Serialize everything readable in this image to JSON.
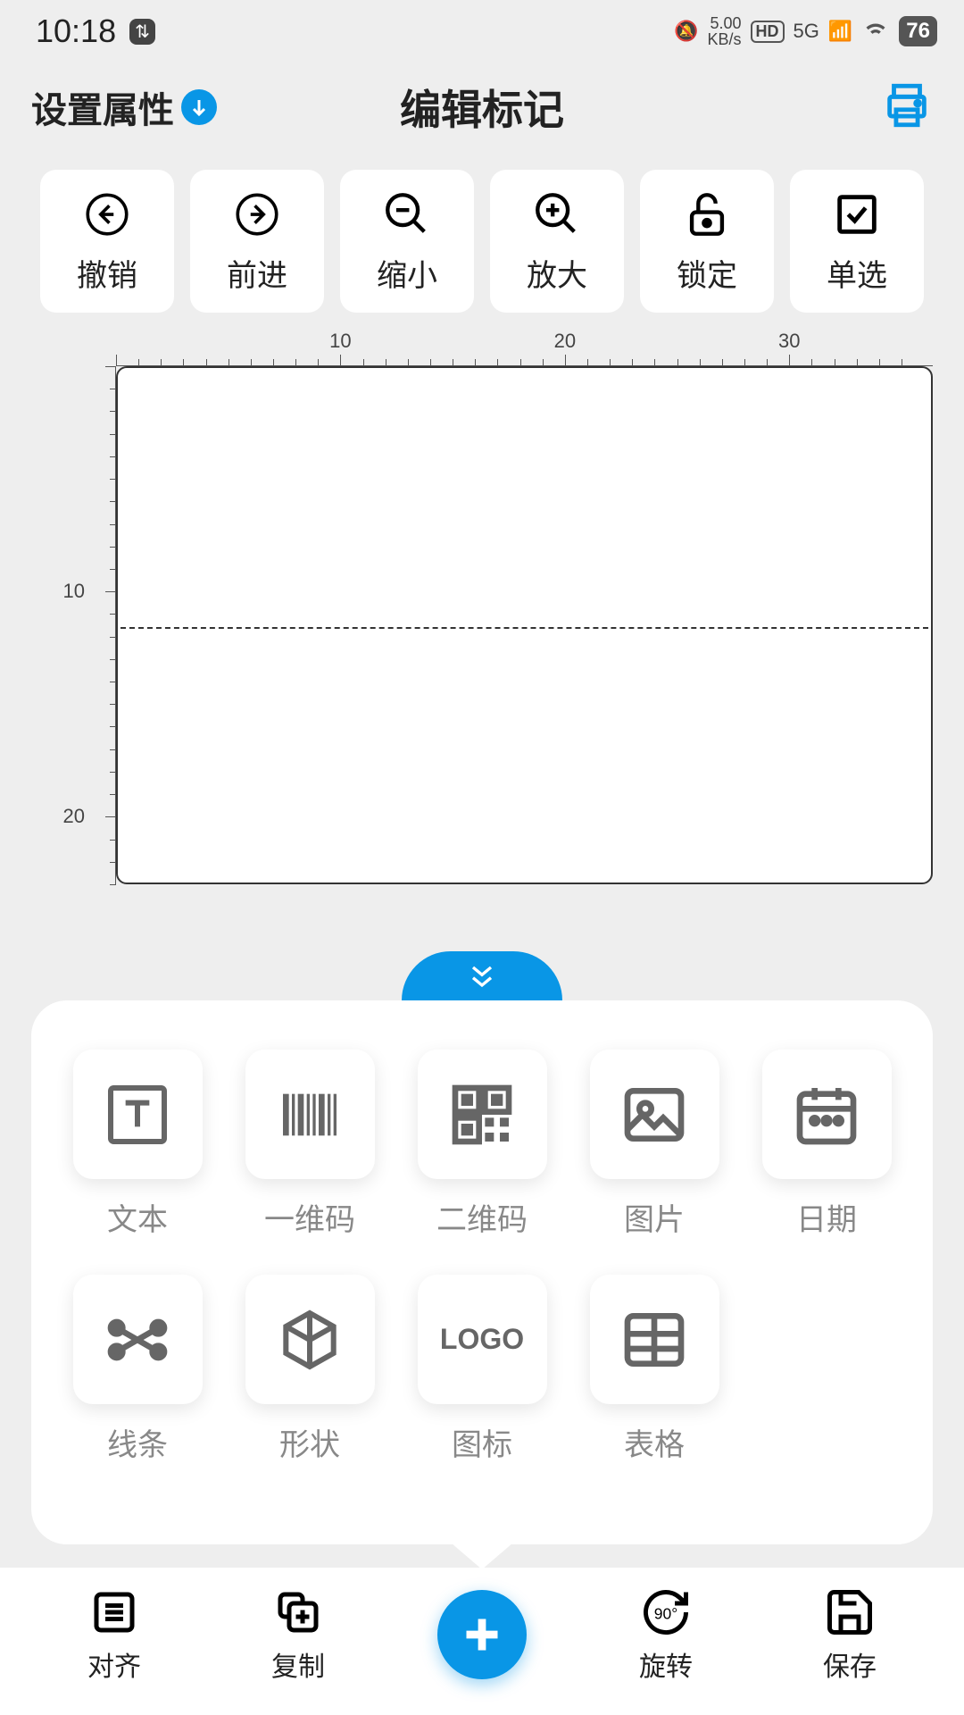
{
  "status": {
    "time": "10:18",
    "speed_val": "5.00",
    "speed_unit": "KB/s",
    "hd": "HD",
    "network": "5G",
    "battery": "76"
  },
  "header": {
    "settings": "设置属性",
    "title": "编辑标记"
  },
  "toolbar": {
    "undo": "撤销",
    "redo": "前进",
    "zoom_out": "缩小",
    "zoom_in": "放大",
    "lock": "锁定",
    "select": "单选"
  },
  "ruler": {
    "h": [
      "10",
      "20",
      "30"
    ],
    "v": [
      "10",
      "20"
    ]
  },
  "panel": {
    "text": "文本",
    "barcode": "一维码",
    "qrcode": "二维码",
    "image": "图片",
    "date": "日期",
    "line": "线条",
    "shape": "形状",
    "logo": "图标",
    "logo_text": "LOGO",
    "table": "表格"
  },
  "bottom": {
    "align": "对齐",
    "copy": "复制",
    "rotate": "旋转",
    "save": "保存"
  }
}
